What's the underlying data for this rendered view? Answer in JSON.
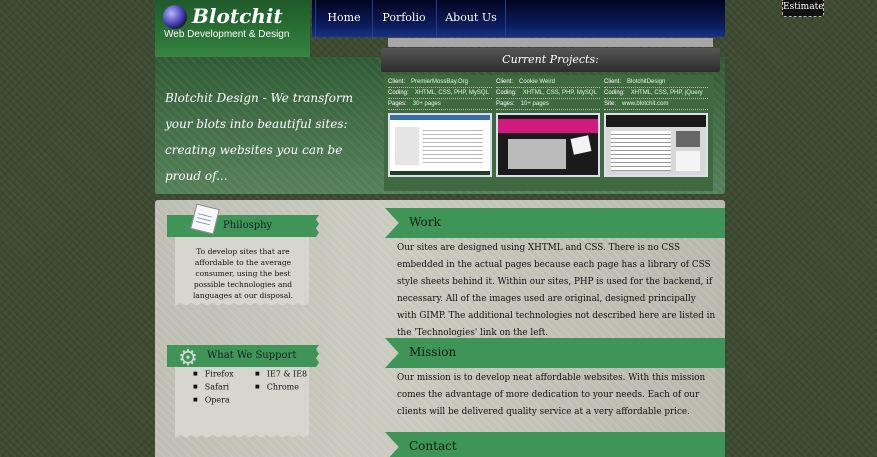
{
  "header": {
    "logo_title": "Blotchit",
    "logo_subtitle": "Web Development & Design",
    "nav": [
      "Home",
      "Porfolio",
      "About Us"
    ],
    "estimate_label": "Estimate"
  },
  "banner": {
    "tagline": "Blotchit Design - We transform your blots into beautiful sites: creating websites you can be proud of..."
  },
  "projects": {
    "title": "Current Projects:",
    "items": [
      {
        "row1_label": "Client:",
        "row1_value": "PremierMossBay.Org",
        "row2_label": "Coding:",
        "row2_value": "XHTML, CSS, PHP, MySQL",
        "row3_label": "Pages:",
        "row3_value": "30+ pages"
      },
      {
        "row1_label": "Client:",
        "row1_value": "Cookie Weird",
        "row2_label": "Coding:",
        "row2_value": "XHTML, CSS, PHP, MySQL",
        "row3_label": "Pages:",
        "row3_value": "10+ pages"
      },
      {
        "row1_label": "Client:",
        "row1_value": "BlotchitDesign",
        "row2_label": "Coding:",
        "row2_value": "XHTML, CSS, PHP, jQuery",
        "row3_label": "Site:",
        "row3_value": "www.blotchit.com"
      }
    ]
  },
  "sidebar": {
    "philosophy": {
      "title": "Philosphy",
      "text": "To develop sites that are affordable to the average consumer, using the best possible technologies and languages at our disposal."
    },
    "support": {
      "title": "What We Support",
      "col1": [
        "Firefox",
        "Safari",
        "Opera"
      ],
      "col2": [
        "IE7 & IE8",
        "Chrome"
      ]
    }
  },
  "sections": {
    "work": {
      "title": "Work",
      "text": "Our sites are designed using XHTML and CSS. There is no CSS embedded in the actual pages because each page has a library of CSS style sheets behind it. Within our sites, PHP is used for the backend, if necessary. All of the images used are original, designed principally with GIMP. The additional technologies not described here are listed in the 'Technologies' link on the left."
    },
    "mission": {
      "title": "Mission",
      "text": "Our mission is to develop neat affordable websites. With this mission comes the advantage of more dedication to your needs. Each of our clients will be delivered quality service at a very affordable price."
    },
    "contact": {
      "title": "Contact"
    }
  },
  "colors": {
    "accent_green": "#3f9557",
    "nav_blue": "#0c1d5e",
    "panel_gray": "#c2c2b7"
  }
}
